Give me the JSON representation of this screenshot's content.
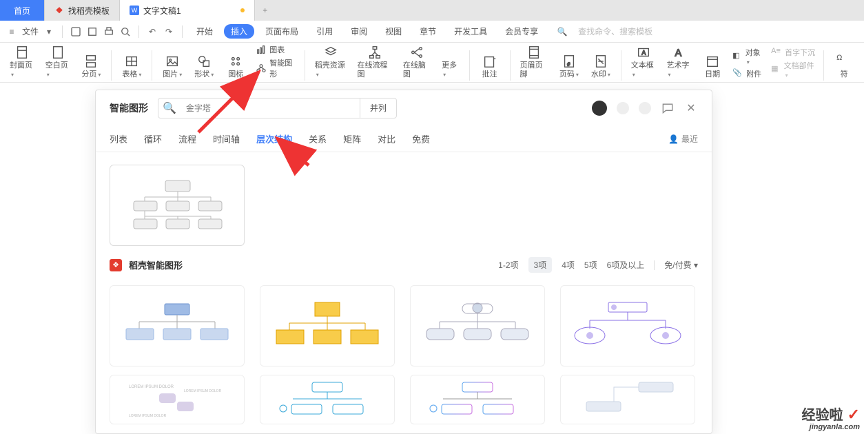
{
  "tabs": {
    "home": "首页",
    "templates": "找稻壳模板",
    "doc": "文字文稿1",
    "new": "+"
  },
  "menubar": {
    "file": "文件",
    "start": "开始",
    "insert": "插入",
    "layout": "页面布局",
    "reference": "引用",
    "review": "审阅",
    "view": "视图",
    "chapter": "章节",
    "devtools": "开发工具",
    "member": "会员专享",
    "search_hint": "查找命令、搜索模板"
  },
  "ribbon": {
    "cover": "封面页",
    "blank": "空白页",
    "pagebreak": "分页",
    "table": "表格",
    "picture": "图片",
    "shape": "形状",
    "icon": "图标",
    "chart": "图表",
    "smart": "智能图形",
    "resources": "稻壳资源",
    "flowchart": "在线流程图",
    "mindmap": "在线脑图",
    "more": "更多",
    "comment": "批注",
    "headerfooter": "页眉页脚",
    "pagenum": "页码",
    "watermark": "水印",
    "textbox": "文本框",
    "wordart": "艺术字",
    "date": "日期",
    "object": "对象",
    "attachment": "附件",
    "dropcap": "首字下沉",
    "docparts": "文档部件",
    "symbol": "符"
  },
  "panel": {
    "title": "智能图形",
    "search_placeholder": "金字塔",
    "go": "并列",
    "tabs": {
      "list": "列表",
      "cycle": "循环",
      "process": "流程",
      "timeline": "时间轴",
      "hierarchy": "层次结构",
      "relation": "关系",
      "matrix": "矩阵",
      "compare": "对比",
      "free": "免费"
    },
    "recent": "最近",
    "section": "稻壳智能图形",
    "filters": {
      "f1": "1-2项",
      "f2": "3项",
      "f3": "4项",
      "f4": "5项",
      "f5": "6项及以上",
      "paid": "免/付费"
    }
  },
  "watermark": {
    "line1": "经验啦",
    "line2": "jingyanla.com"
  }
}
